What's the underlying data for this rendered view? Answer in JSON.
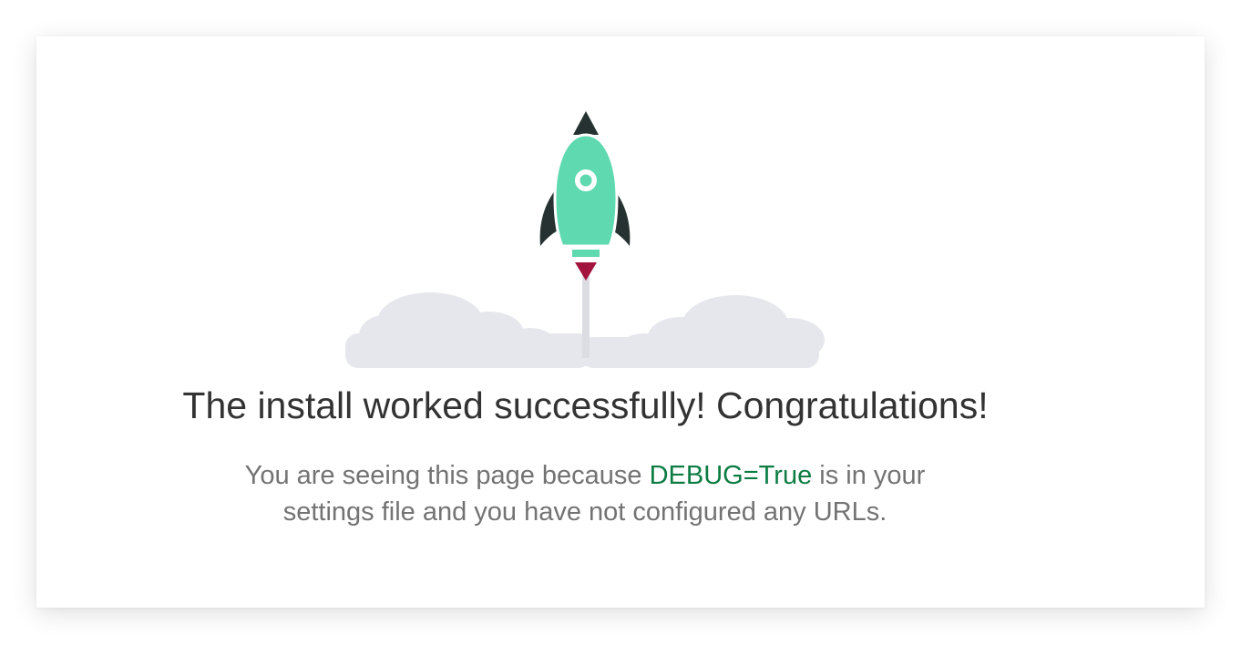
{
  "headline": "The install worked successfully! Congratulations!",
  "message": {
    "before": "You are seeing this page because ",
    "setting": "DEBUG=True",
    "after": " is in your settings file and you have not configured any URLs."
  },
  "illustration": {
    "icon": "rocket-launch",
    "colors": {
      "rocket_body": "#5fd9b0",
      "rocket_dark": "#253231",
      "flame": "#a2133d",
      "cloud": "#e6e7ec",
      "trail": "#dcdde3"
    }
  },
  "colors": {
    "headline": "#333333",
    "text": "#737373",
    "debug_accent": "#0c7c43"
  }
}
